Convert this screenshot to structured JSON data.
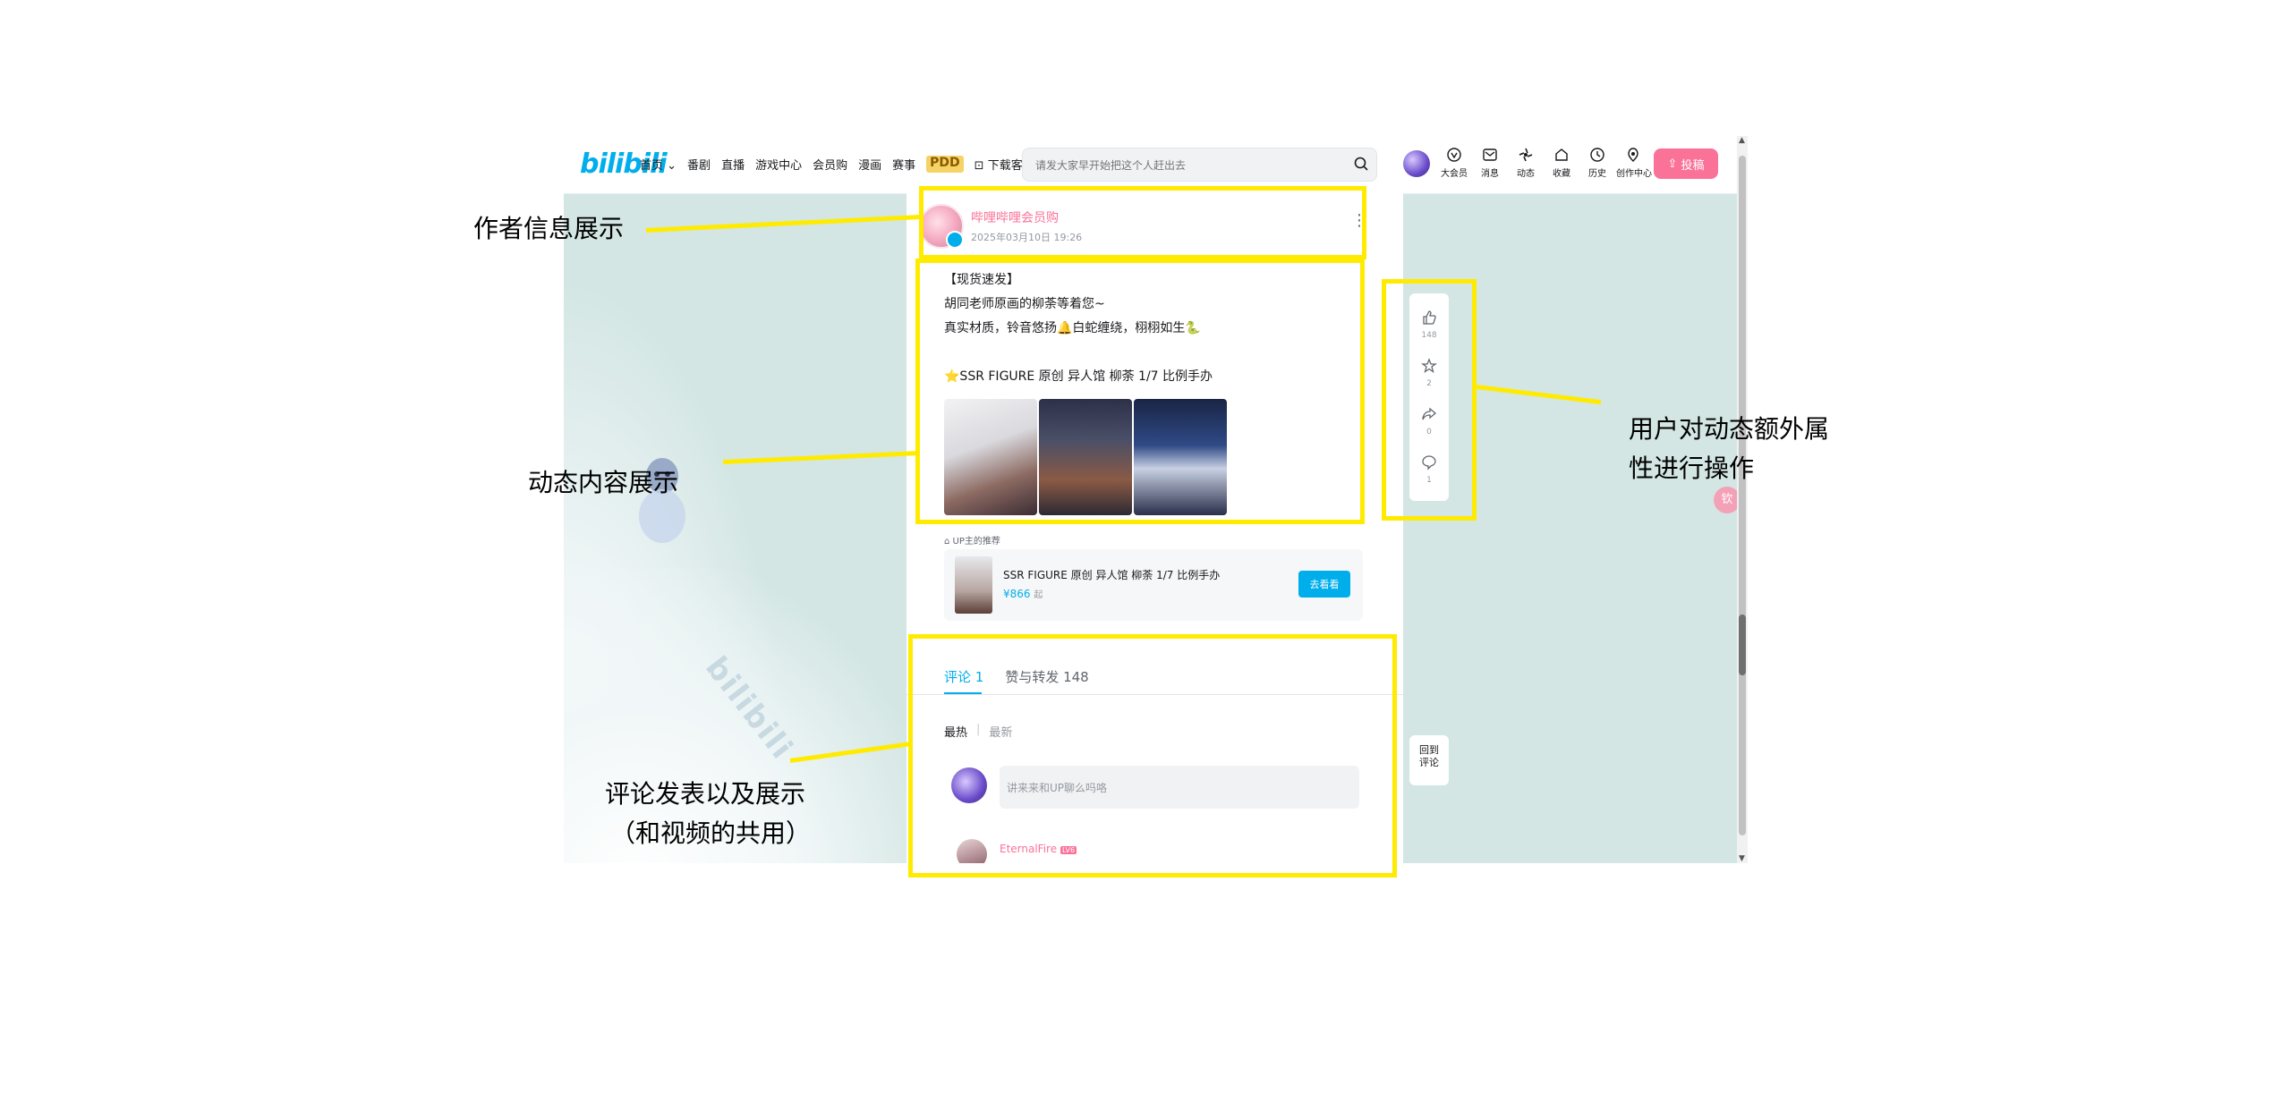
{
  "header": {
    "logo": "bilibili",
    "nav": [
      "首页",
      "番剧",
      "直播",
      "游戏中心",
      "会员购",
      "漫画",
      "赛事"
    ],
    "nav_home_chevron": "chevron-down-icon",
    "pdd_label": "PDD",
    "download_label": "下载客户端",
    "search_placeholder": "请发大家早开始把这个人赶出去",
    "right_icons": [
      {
        "icon": "vip-icon",
        "label": "大会员"
      },
      {
        "icon": "message-icon",
        "label": "消息"
      },
      {
        "icon": "dynamic-icon",
        "label": "动态"
      },
      {
        "icon": "favorite-icon",
        "label": "收藏"
      },
      {
        "icon": "history-icon",
        "label": "历史"
      },
      {
        "icon": "creation-icon",
        "label": "创作中心"
      }
    ],
    "upload_label": "投稿"
  },
  "post": {
    "author_name": "哔哩哔哩会员购",
    "time": "2025年03月10日 19:26",
    "lines": [
      "【现货速发】",
      "胡同老师原画的柳荼等着您~",
      "真实材质，铃音悠扬🔔白蛇缠绕，栩栩如生🐍",
      "",
      "⭐SSR FIGURE 原创 异人馆 柳荼 1/7 比例手办"
    ],
    "images": [
      "figure-image-1",
      "figure-image-2",
      "figure-image-3"
    ]
  },
  "goods": {
    "label": "UP主的推荐",
    "name": "SSR FIGURE 原创 异人馆 柳荼 1/7 比例手办",
    "price": "¥866",
    "price_suffix": "起",
    "button": "去看看"
  },
  "comments": {
    "tabs": [
      "评论 1",
      "赞与转发 148"
    ],
    "sort": [
      "最热",
      "最新"
    ],
    "input_placeholder": "讲来来和UP聊么吗咯",
    "first_user": "EternalFire",
    "first_user_level": "LV6"
  },
  "actions": [
    {
      "icon": "like-icon",
      "count": "148"
    },
    {
      "icon": "star-icon",
      "count": "2"
    },
    {
      "icon": "share-icon",
      "count": "0"
    },
    {
      "icon": "comment-icon",
      "count": "1"
    }
  ],
  "back_button": "回到\n评论",
  "pink_float": "钦",
  "background_watermark": "bilibili",
  "annotations": {
    "author": "作者信息展示",
    "content": "动态内容展示",
    "actions_line1": "用户对动态额外属",
    "actions_line2": "性进行操作",
    "comments_line1": "评论发表以及展示",
    "comments_line2": "（和视频的共用）"
  },
  "colors": {
    "annotation": "#ffeb00",
    "brand_blue": "#00aeec",
    "brand_pink": "#fb7299",
    "page_bg": "#d3e6e3"
  }
}
